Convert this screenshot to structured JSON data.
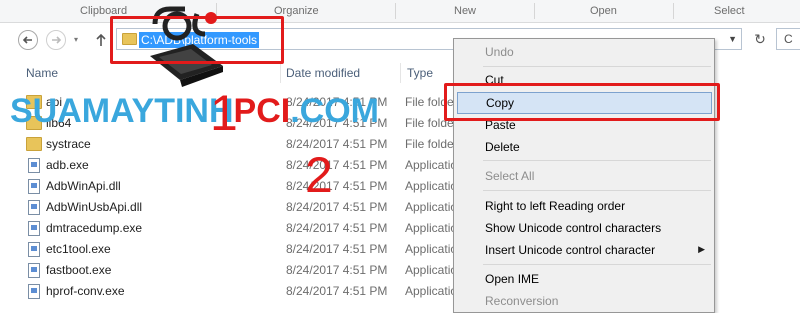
{
  "ribbon": {
    "groups": [
      "Clipboard",
      "Organize",
      "New",
      "Open",
      "Select"
    ]
  },
  "address_bar": {
    "path": "C:\\ADB\\platform-tools"
  },
  "columns": {
    "name": "Name",
    "date_modified": "Date modified",
    "type": "Type"
  },
  "files": [
    {
      "name": "api",
      "date": "8/24/2017 4:51 PM",
      "type": "File folder",
      "kind": "folder-icon"
    },
    {
      "name": "lib64",
      "date": "8/24/2017 4:51 PM",
      "type": "File folder",
      "kind": "folder-icon"
    },
    {
      "name": "systrace",
      "date": "8/24/2017 4:51 PM",
      "type": "File folder",
      "kind": "folder-icon"
    },
    {
      "name": "adb.exe",
      "date": "8/24/2017 4:51 PM",
      "type": "Application",
      "kind": "application-icon"
    },
    {
      "name": "AdbWinApi.dll",
      "date": "8/24/2017 4:51 PM",
      "type": "Application extension",
      "kind": "dll-icon"
    },
    {
      "name": "AdbWinUsbApi.dll",
      "date": "8/24/2017 4:51 PM",
      "type": "Application extension",
      "kind": "dll-icon"
    },
    {
      "name": "dmtracedump.exe",
      "date": "8/24/2017 4:51 PM",
      "type": "Application",
      "kind": "application-icon"
    },
    {
      "name": "etc1tool.exe",
      "date": "8/24/2017 4:51 PM",
      "type": "Application",
      "kind": "application-icon"
    },
    {
      "name": "fastboot.exe",
      "date": "8/24/2017 4:51 PM",
      "type": "Application",
      "kind": "application-icon"
    },
    {
      "name": "hprof-conv.exe",
      "date": "8/24/2017 4:51 PM",
      "type": "Application",
      "kind": "application-icon"
    }
  ],
  "context_menu": {
    "undo": "Undo",
    "cut": "Cut",
    "copy": "Copy",
    "paste": "Paste",
    "delete": "Delete",
    "select_all": "Select All",
    "rtl": "Right to left Reading order",
    "show_unicode": "Show Unicode control characters",
    "insert_unicode": "Insert Unicode control character",
    "open_ime": "Open IME",
    "reconversion": "Reconversion"
  },
  "annotations": {
    "step1": "1",
    "step2": "2"
  },
  "watermark": {
    "part1": "SUAMAYTINH",
    "part2": "PCI",
    "part3": ".COM"
  },
  "colors": {
    "accent_red": "#e21b1b",
    "selection_blue": "#3399ff",
    "watermark_blue": "#3aa7dd"
  }
}
